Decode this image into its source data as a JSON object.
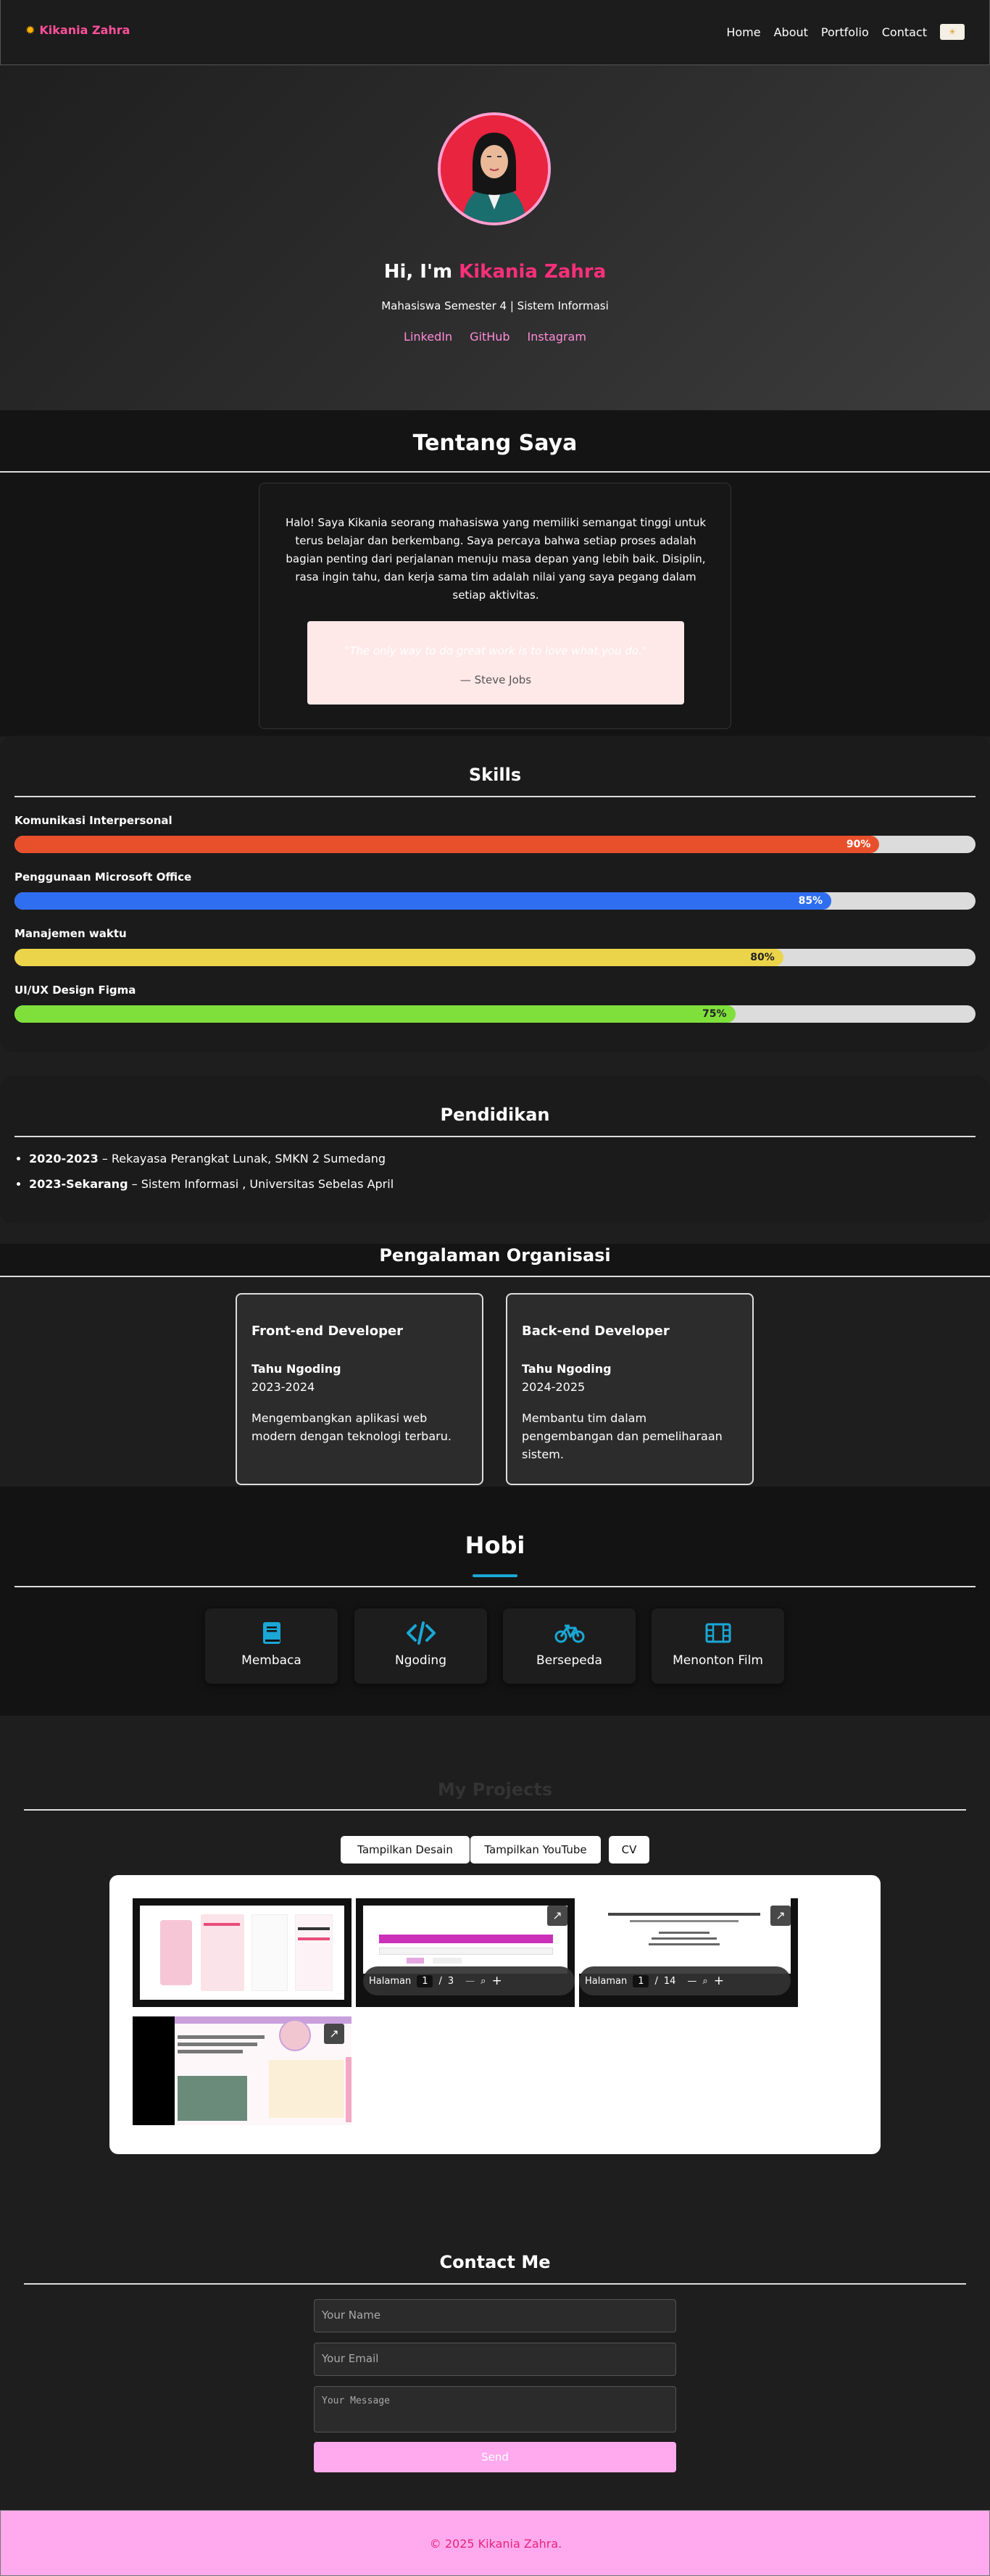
{
  "nav": {
    "brand": "Kikania Zahra",
    "links": [
      "Home",
      "About",
      "Portfolio",
      "Contact"
    ]
  },
  "hero": {
    "greeting": "Hi, I'm",
    "name": "Kikania Zahra",
    "subtitle": "Mahasiswa Semester 4 | Sistem Informasi",
    "socials": [
      "LinkedIn",
      "GitHub",
      "Instagram"
    ]
  },
  "about": {
    "title": "Tentang Saya",
    "text": "Halo! Saya Kikania seorang mahasiswa yang memiliki semangat tinggi untuk terus belajar dan berkembang. Saya percaya bahwa setiap proses adalah bagian penting dari perjalanan menuju masa depan yang lebih baik. Disiplin, rasa ingin tahu, dan kerja sama tim adalah nilai yang saya pegang dalam setiap aktivitas.",
    "quote": "\"The only way to do great work is to love what you do.\"",
    "quote_author": "— Steve Jobs"
  },
  "skills": {
    "title": "Skills",
    "items": [
      {
        "label": "Komunikasi Interpersonal",
        "percent": 90,
        "percent_text": "90%",
        "color": "#e8502c"
      },
      {
        "label": "Penggunaan Microsoft Office",
        "percent": 85,
        "percent_text": "85%",
        "color": "#2f6ef0"
      },
      {
        "label": "Manajemen waktu",
        "percent": 80,
        "percent_text": "80%",
        "color": "#ecd44a"
      },
      {
        "label": "UI/UX Design Figma",
        "percent": 75,
        "percent_text": "75%",
        "color": "#7fe03c"
      }
    ]
  },
  "education": {
    "title": "Pendidikan",
    "items": [
      {
        "years": "2020-2023",
        "text": " – Rekayasa Perangkat Lunak, SMKN 2 Sumedang"
      },
      {
        "years": "2023-Sekarang",
        "text": " – Sistem Informasi , Universitas Sebelas April"
      }
    ]
  },
  "organization": {
    "title": "Pengalaman Organisasi",
    "cards": [
      {
        "title": "Front-end Developer",
        "year_label": "Tahu Ngoding",
        "years": "2023-2024",
        "desc": "Mengembangkan aplikasi web modern dengan teknologi terbaru."
      },
      {
        "title": "Back-end Developer",
        "year_label": "Tahu Ngoding",
        "years": "2024-2025",
        "desc": "Membantu tim dalam pengembangan dan pemeliharaan sistem."
      }
    ]
  },
  "hobby": {
    "title": "Hobi",
    "items": [
      {
        "label": "Membaca",
        "icon": "book-icon"
      },
      {
        "label": "Ngoding",
        "icon": "code-icon"
      },
      {
        "label": "Bersepeda",
        "icon": "bicycle-icon"
      },
      {
        "label": "Menonton Film",
        "icon": "film-icon"
      }
    ],
    "accent": "#1aa7d6"
  },
  "projects": {
    "title": "My Projects",
    "buttons": [
      "Tampilkan Desain",
      "Tampilkan YouTube",
      "CV"
    ],
    "pdf_viewers": [
      {
        "label": "Halaman",
        "page": "1",
        "sep": "/",
        "total": "3"
      },
      {
        "label": "Halaman",
        "page": "1",
        "sep": "/",
        "total": "14"
      }
    ]
  },
  "contact": {
    "title": "Contact Me",
    "name_placeholder": "Your Name",
    "email_placeholder": "Your Email",
    "message_placeholder": "Your Message",
    "send_label": "Send"
  },
  "footer": {
    "text": "© 2025 Kikania Zahra."
  },
  "colors": {
    "accent_pink": "#ff2f7a",
    "footer_bg": "#ffaaee"
  }
}
